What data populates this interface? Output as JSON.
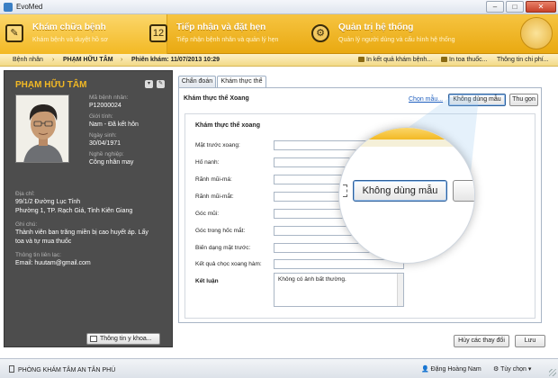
{
  "window": {
    "title": "EvoMed",
    "minimize": "–",
    "maximize": "□",
    "close": "✕"
  },
  "modules": [
    {
      "title": "Khám chữa bệnh",
      "subtitle": "Khám bệnh và duyệt hồ sơ",
      "icon": "clipboard-icon"
    },
    {
      "title": "Tiếp nhận và đặt hẹn",
      "subtitle": "Tiếp nhận bệnh nhân và quản lý hẹn",
      "icon": "calendar-icon"
    },
    {
      "title": "Quản trị hệ thống",
      "subtitle": "Quản lý người dùng và cấu hình hệ thống",
      "icon": "gear-icon"
    }
  ],
  "logo_text": "LOGO",
  "breadcrumb": {
    "root": "Bệnh nhân",
    "patient": "PHẠM HỮU TÂM",
    "session": "Phiên khám: 11/07/2013 10:29"
  },
  "toolbar": {
    "print_result": "In kết quả khám bệnh...",
    "print_prescription": "In toa thuốc...",
    "cost_info": "Thông tin chi phí..."
  },
  "patient": {
    "name": "PHẠM HỮU TÂM",
    "id_label": "Mã bệnh nhân:",
    "id": "P12000024",
    "gender_label": "Giới tính:",
    "gender": "Nam - Đã kết hôn",
    "dob_label": "Ngày sinh:",
    "dob": "30/04/1971",
    "job_label": "Nghề nghiệp:",
    "job": "Công nhân may",
    "address_label": "Địa chỉ:",
    "address_1": "99/1/2 Đường Lục Tỉnh",
    "address_2": "Phường 1, TP. Rạch Giá, Tỉnh Kiên Giang",
    "note_label": "Ghi chú:",
    "note_1": "Thành viên ban trăng miền bị cao huyết áp. Lấy",
    "note_2": "toa và tự mua thuốc",
    "contact_label": "Thông tin liên lạc:",
    "email": "Email: huutam@gmail.com",
    "med_info_button": "Thông tin y khoa..."
  },
  "tabs": [
    {
      "label": "Chẩn đoán",
      "active": false
    },
    {
      "label": "Khám thực thể",
      "active": true
    }
  ],
  "form": {
    "title": "Khám thực thể Xoang",
    "select_link": "Chọn mẫu...",
    "no_template_button": "Không dùng mẫu",
    "collapse_button": "Thu gọn",
    "section_title": "Khám thực thể xoang",
    "fields": [
      {
        "label": "Mặt trước xoang:",
        "value": ""
      },
      {
        "label": "Hố nanh:",
        "value": ""
      },
      {
        "label": "Rãnh mũi-má:",
        "value": ""
      },
      {
        "label": "Rãnh mũi-mắt:",
        "value": ""
      },
      {
        "label": "Góc mũi:",
        "value": ""
      },
      {
        "label": "Góc trong hốc mắt:",
        "value": ""
      },
      {
        "label": "Biến dạng mặt trước:",
        "value": ""
      },
      {
        "label": "Kết quả chọc xoang hàm:",
        "value": ""
      }
    ],
    "conclusion_label": "Kết luận",
    "conclusion_value": "Không có ảnh bất thường."
  },
  "actions": {
    "cancel": "Hủy các thay đổi",
    "save": "Lưu"
  },
  "status": {
    "clinic": "PHÒNG KHÁM TÂM AN TÂN PHÚ",
    "user": "Đặng Hoàng Nam",
    "options": "Tùy chọn"
  },
  "magnifier": {
    "button_label": "Không dùng mẫu"
  }
}
